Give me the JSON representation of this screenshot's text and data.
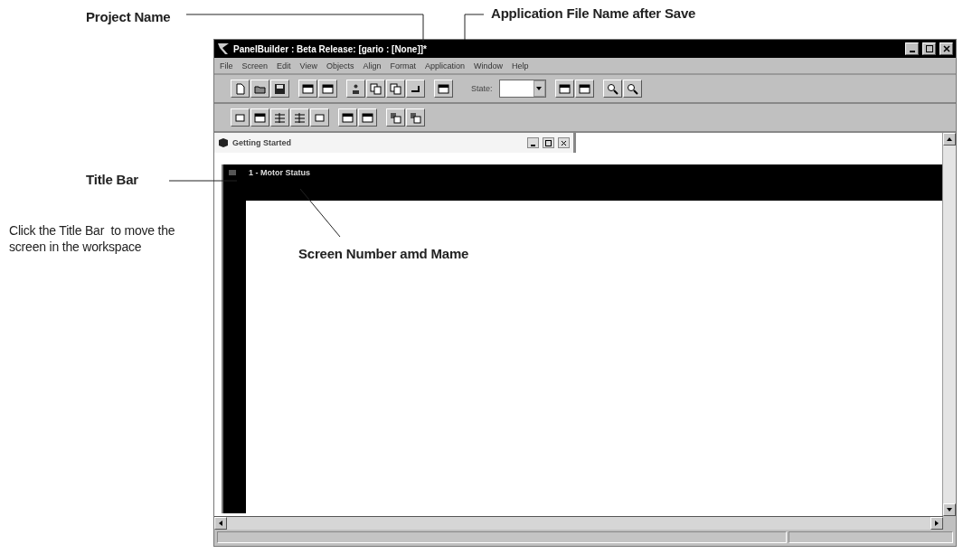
{
  "annotations": {
    "project_name": "Project Name",
    "file_name": "Application File Name after Save",
    "title_bar": "Title Bar",
    "title_bar_note": "Click the Title Bar  to move the screen in the workspace",
    "screen_name": "Screen Number amd Mame"
  },
  "window": {
    "title": "PanelBuilder : Beta Release: [gario : [None]]*"
  },
  "menu": [
    {
      "label": "File"
    },
    {
      "label": "Screen"
    },
    {
      "label": "Edit"
    },
    {
      "label": "View"
    },
    {
      "label": "Objects"
    },
    {
      "label": "Align"
    },
    {
      "label": "Format"
    },
    {
      "label": "Application"
    },
    {
      "label": "Window"
    },
    {
      "label": "Help"
    }
  ],
  "toolbar": {
    "state_label": "State:"
  },
  "child_window": {
    "title": "Getting Started"
  },
  "screen": {
    "title": "1 - Motor Status"
  }
}
